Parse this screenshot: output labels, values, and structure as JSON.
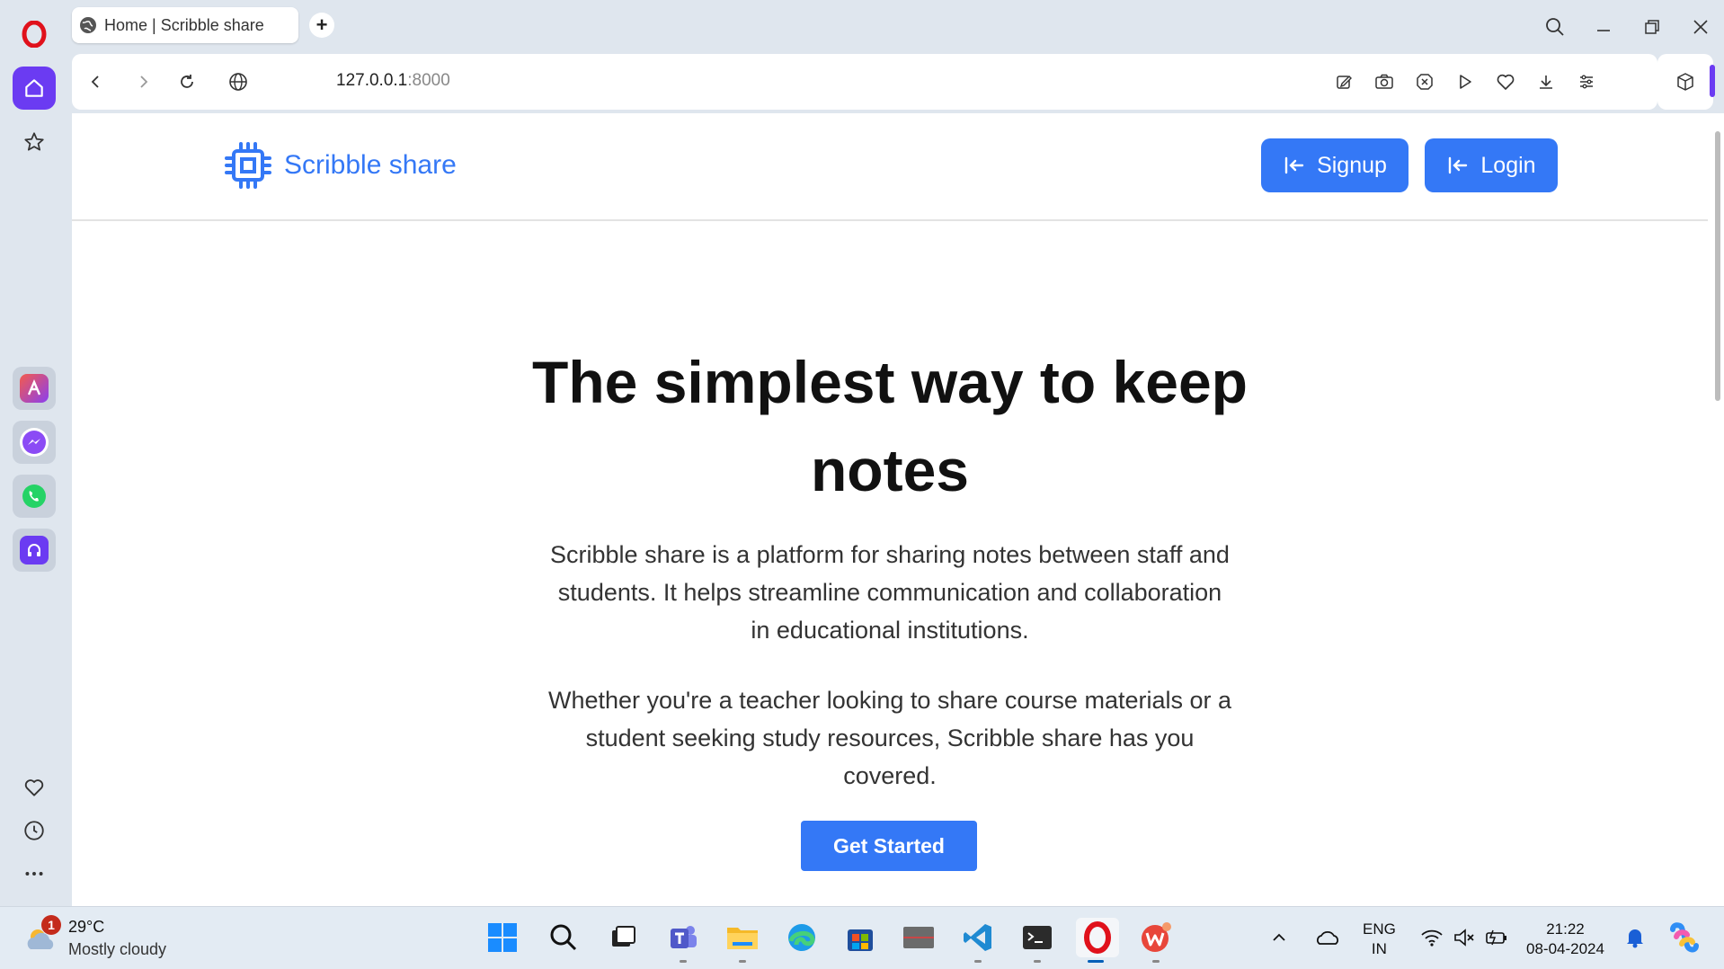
{
  "browser": {
    "tab_title": "Home | Scribble share",
    "new_tab_label": "+",
    "url_host": "127.0.0.1",
    "url_port": ":8000",
    "accent_color": "#6b3bf2"
  },
  "sidebar": {
    "items": [
      "opera-logo",
      "home-icon",
      "star-icon",
      "aria-icon",
      "messenger-icon",
      "whatsapp-icon",
      "music-player-icon"
    ],
    "bottom": [
      "heart-icon",
      "history-icon",
      "more-icon"
    ]
  },
  "site": {
    "brand": "Scribble share",
    "signup_label": "Signup",
    "login_label": "Login",
    "brand_color": "#3478f6"
  },
  "hero": {
    "title_line1": "The simplest way to keep",
    "title_line2": "notes",
    "para1_line1": "Scribble share is a platform for sharing notes between staff and",
    "para1_line2": "students. It helps streamline communication and collaboration",
    "para1_line3": "in educational institutions.",
    "para2_line1": "Whether you're a teacher looking to share course materials or a",
    "para2_line2": "student seeking study resources, Scribble share has you",
    "para2_line3": "covered.",
    "cta_label": "Get Started"
  },
  "taskbar": {
    "weather_badge": "1",
    "weather_temp": "29°C",
    "weather_desc": "Mostly cloudy",
    "lang_line1": "ENG",
    "lang_line2": "IN",
    "time": "21:22",
    "date": "08-04-2024"
  }
}
